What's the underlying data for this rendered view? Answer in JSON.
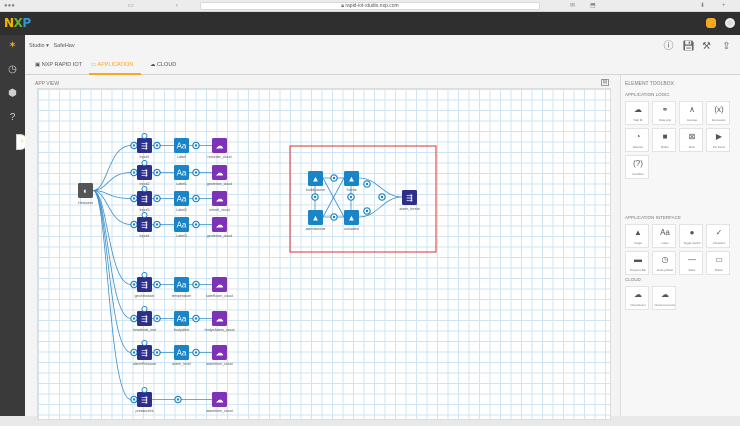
{
  "browser": {
    "url": "rapid-iot-studio.nxp.com"
  },
  "app": {
    "logo": "NXP"
  },
  "breadcrumb": {
    "studio": "Studio",
    "sep": "▾",
    "project": "SafeHav"
  },
  "tabs": [
    {
      "label": "NXP RAPID IOT",
      "icon": "chip-icon"
    },
    {
      "label": "APPLICATION",
      "icon": "application-icon"
    },
    {
      "label": "CLOUD",
      "icon": "cloud-icon"
    }
  ],
  "canvas": {
    "title": "APP VIEW",
    "source_node": "Hexiwear",
    "rows": [
      {
        "input": "Input1",
        "label": "Label",
        "cloud": "recorder_cloud"
      },
      {
        "input": "Input2",
        "label": "Label1",
        "cloud": "geofence_cloud"
      },
      {
        "input": "Input3",
        "label": "Label2",
        "cloud": "inherit_cloud"
      },
      {
        "input": "Input4",
        "label": "Label3",
        "cloud": "geofence_cloud"
      },
      {
        "input": "geoIntrusion",
        "label": "temperature",
        "cloud": "safeRoom_cloud"
      },
      {
        "input": "heartbeat_inst",
        "label": "bodyAlert",
        "cloud": "bodyeAlarm_cloud"
      },
      {
        "input": "alarmPressure",
        "label": "alarm_level",
        "cloud": "alarmtime_cloud"
      },
      {
        "input": "pressureInt",
        "label": "",
        "cloud": "alarmtime_cloud"
      }
    ],
    "group": {
      "nodes": [
        "buildisource",
        "Scene",
        "alarmsource",
        "unloaded"
      ],
      "output": "alarm_threat"
    }
  },
  "toolbox": {
    "title": "ELEMENT TOOLBOX",
    "sections": [
      {
        "title": "APPLICATION LOGIC",
        "items": [
          {
            "label": "Wait ID",
            "icon": "cloud-sync-icon",
            "glyph": "☁"
          },
          {
            "label": "Data Link",
            "icon": "link-icon",
            "glyph": "⚭"
          },
          {
            "label": "Average",
            "icon": "average-icon",
            "glyph": "∧"
          },
          {
            "label": "Expression",
            "icon": "expression-icon",
            "glyph": "(x)"
          },
          {
            "label": "Detector",
            "icon": "pie-icon",
            "glyph": "◔"
          },
          {
            "label": "Buffer",
            "icon": "cube-icon",
            "glyph": "■"
          },
          {
            "label": "MAC",
            "icon": "mac-icon",
            "glyph": "⊠"
          },
          {
            "label": "Per Event",
            "icon": "play-icon",
            "glyph": "▶"
          },
          {
            "label": "Condition",
            "icon": "condition-icon",
            "glyph": "(?)"
          }
        ]
      },
      {
        "title": "APPLICATION INTERFACE",
        "items": [
          {
            "label": "Image",
            "icon": "image-icon",
            "glyph": "▲"
          },
          {
            "label": "Label",
            "icon": "label-icon",
            "glyph": "Aa"
          },
          {
            "label": "Toggle Switch",
            "icon": "toggle-icon",
            "glyph": "●"
          },
          {
            "label": "Checkbox",
            "icon": "checkbox-icon",
            "glyph": "✓"
          },
          {
            "label": "Progress Bar",
            "icon": "progress-icon",
            "glyph": "▬"
          },
          {
            "label": "Analog Meter",
            "icon": "meter-icon",
            "glyph": "◷"
          },
          {
            "label": "Slider",
            "icon": "slider-icon",
            "glyph": "—"
          },
          {
            "label": "Button",
            "icon": "button-icon",
            "glyph": "▭"
          }
        ]
      },
      {
        "title": "CLOUD",
        "items": [
          {
            "label": "Cloud Event",
            "icon": "cloud-event-icon",
            "glyph": "☁"
          },
          {
            "label": "Cloud Connector",
            "icon": "cloud-connector-icon",
            "glyph": "☁"
          }
        ]
      }
    ]
  },
  "colors": {
    "accent": "#f7a823",
    "node_blue": "#1a84c8",
    "node_navy": "#2d2f8b",
    "node_purple": "#7c33b8",
    "selection": "#d9322b"
  }
}
